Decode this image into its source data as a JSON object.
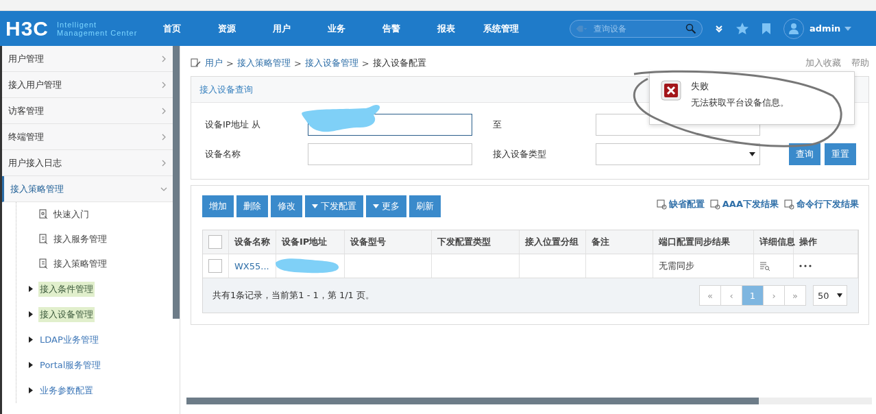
{
  "nav": {
    "logo": "H3C",
    "tagline_1": "Intelligent",
    "tagline_2": "Management Center",
    "items": [
      {
        "label": "首页"
      },
      {
        "label": "资源"
      },
      {
        "label": "用户"
      },
      {
        "label": "业务"
      },
      {
        "label": "告警"
      },
      {
        "label": "报表"
      },
      {
        "label": "系统管理"
      }
    ],
    "search": {
      "placeholder": "查询设备"
    },
    "user": "admin"
  },
  "sidebar": {
    "items": [
      {
        "label": "用户管理",
        "expanded": false
      },
      {
        "label": "接入用户管理",
        "expanded": false
      },
      {
        "label": "访客管理",
        "expanded": false
      },
      {
        "label": "终端管理",
        "expanded": false
      },
      {
        "label": "用户接入日志",
        "expanded": false
      },
      {
        "label": "接入策略管理",
        "expanded": true,
        "children": [
          {
            "label": "快速入门",
            "kind": "leaf"
          },
          {
            "label": "接入服务管理",
            "kind": "leaf"
          },
          {
            "label": "接入策略管理",
            "kind": "leaf"
          },
          {
            "label": "接入条件管理",
            "kind": "folder",
            "highlighted": true
          },
          {
            "label": "接入设备管理",
            "kind": "folder",
            "highlighted": true
          },
          {
            "label": "LDAP业务管理",
            "kind": "folder",
            "highlighted": false
          },
          {
            "label": "Portal服务管理",
            "kind": "folder",
            "highlighted": false
          },
          {
            "label": "业务参数配置",
            "kind": "folder",
            "highlighted": false
          }
        ]
      }
    ]
  },
  "breadcrumb": [
    "用户",
    "接入策略管理",
    "接入设备管理",
    "接入设备配置"
  ],
  "breadcrumb_separator": ">",
  "links": [
    "加入收藏",
    "帮助"
  ],
  "query": {
    "title": "接入设备查询",
    "fields": [
      {
        "label": "设备IP地址 从",
        "kind": "text",
        "redacted": true
      },
      {
        "label": "至",
        "kind": "text",
        "redacted": false
      },
      {
        "label": "设备名称",
        "kind": "text",
        "redacted": false
      },
      {
        "label": "接入设备类型",
        "kind": "select",
        "redacted": false
      }
    ],
    "buttons": [
      "查询",
      "重置"
    ]
  },
  "toolbar": {
    "buttons": [
      {
        "label": "增加",
        "dropdown": false
      },
      {
        "label": "删除",
        "dropdown": false
      },
      {
        "label": "修改",
        "dropdown": false
      },
      {
        "label": "下发配置",
        "dropdown": true
      },
      {
        "label": "更多",
        "dropdown": true
      },
      {
        "label": "刷新",
        "dropdown": false
      }
    ],
    "links": [
      "缺省配置",
      "AAA下发结果",
      "命令行下发结果"
    ]
  },
  "table": {
    "select_all_checked": false,
    "columns": [
      {
        "label": "设备名称",
        "kind": "text"
      },
      {
        "label": "设备IP地址",
        "kind": "text"
      },
      {
        "label": "设备型号",
        "kind": "text"
      },
      {
        "label": "下发配置类型",
        "kind": "text"
      },
      {
        "label": "接入位置分组",
        "kind": "text"
      },
      {
        "label": "备注",
        "kind": "text"
      },
      {
        "label": "端口配置同步结果",
        "kind": "text"
      },
      {
        "label": "详细信息",
        "kind": "detail"
      },
      {
        "label": "操作",
        "kind": "ops"
      }
    ],
    "rows": [
      {
        "checked": false,
        "cells": [
          "WX55...",
          "",
          "",
          "",
          "",
          "",
          "无需同步"
        ],
        "redacted_ip": true
      }
    ]
  },
  "pagination": {
    "summary": "共有1条记录，当前第1 - 1，第 1/1 页。",
    "first": "«",
    "previous": "‹",
    "pages": [
      {
        "label": "1",
        "selected": true
      }
    ],
    "next": "›",
    "last": "»",
    "page_size": "50"
  },
  "toast": {
    "title": "失败",
    "message": "无法获取平台设备信息。"
  }
}
